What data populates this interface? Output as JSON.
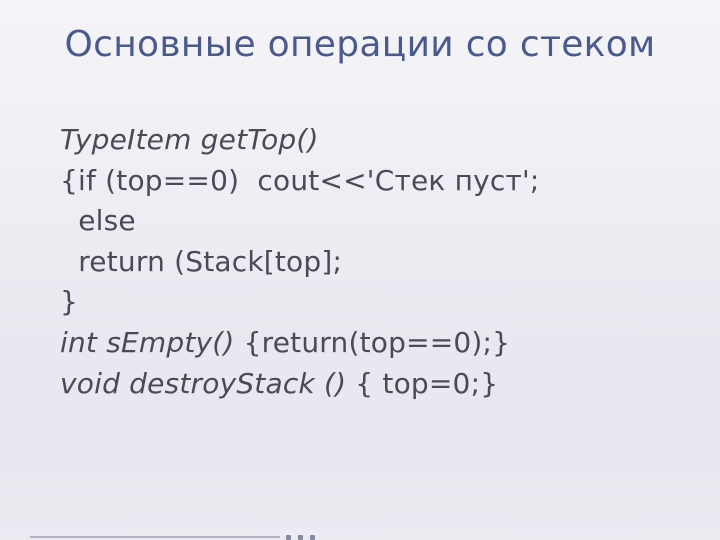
{
  "slide": {
    "title": "Основные операции со стеком",
    "lines": [
      "TypeItem getTop()",
      "{if (top==0)  cout<<'Стек пуст';",
      "  else ",
      "  return (Stack[top];",
      "}",
      "int sEmpty() {return(top==0);}",
      "",
      "void destroyStack () { top=0;}"
    ],
    "line_styles": [
      "italic",
      "",
      "",
      "",
      "",
      "mixed",
      "",
      "mixed"
    ]
  }
}
